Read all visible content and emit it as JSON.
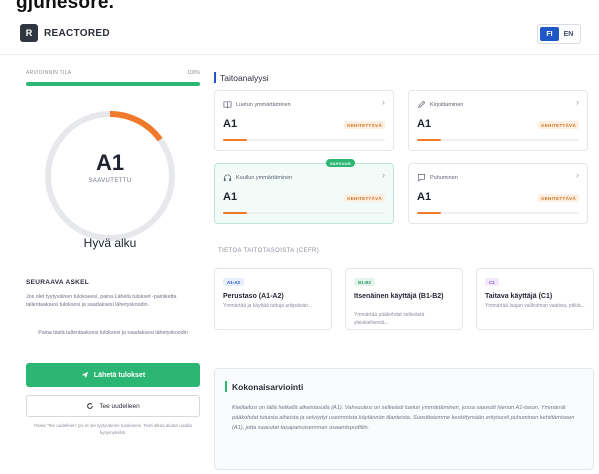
{
  "cropped_heading": "gjuhësorë.",
  "brand": {
    "logo_letter": "R",
    "name": "REACTORED"
  },
  "language": {
    "options": [
      "FI",
      "EN"
    ],
    "active": "FI"
  },
  "progress": {
    "label": "ARVIOINNIN TILA",
    "percent_text": "100%",
    "value": 1.0
  },
  "overall_level": {
    "level": "A1",
    "status": "SAAVUTETTU",
    "ring_fraction": 0.15
  },
  "feedback": "Hyvä alku",
  "next_step": {
    "title": "SEURAAVA ASKEL",
    "text": "Jos olet tyytyväinen tulokseesi, paina Lähetä tulokset -painiketta tallentaaksesi tuloksesi ja saadaksesi lähetyskoodin.",
    "save_note": "Paina tästä tallentaaksesi tuloksesi ja saadaksesi lähetyskoodin",
    "send_label": "Lähetä tulokset",
    "retry_label": "Tee uudelleen",
    "footnote": "Paina 'Tee uudelleen' jos et ole tyytyväinen tulokseesi. Testi alkaa alusta uusilla kysymyksillä."
  },
  "skills_section": {
    "title": "Taitoanalyysi",
    "cards": [
      {
        "name": "Luetun ymmärtäminen",
        "icon": "book-icon",
        "level": "A1",
        "badge": "KEHITETTÄVÄ",
        "progress": 0.15,
        "highlight": false,
        "strength": ""
      },
      {
        "name": "Kirjoittaminen",
        "icon": "pencil-icon",
        "level": "A1",
        "badge": "KEHITETTÄVÄ",
        "progress": 0.15,
        "highlight": false,
        "strength": ""
      },
      {
        "name": "Kuullun ymmärtäminen",
        "icon": "headphones-icon",
        "level": "A1",
        "badge": "KEHITETTÄVÄ",
        "progress": 0.15,
        "highlight": true,
        "strength": "VAHVUUS"
      },
      {
        "name": "Puhuminen",
        "icon": "chat-icon",
        "level": "A1",
        "badge": "KEHITETTÄVÄ",
        "progress": 0.15,
        "highlight": false,
        "strength": ""
      }
    ]
  },
  "cefr": {
    "title": "TIETOA TAITOTASOISTA (CEFR)",
    "cards": [
      {
        "tag": "A1-A2",
        "name": "Perustaso (A1-A2)",
        "desc": "Ymmärtää ja käyttää tuttuja arkipäivän...",
        "tag_color": "#1f57c8",
        "tag_bg": "#e8effc"
      },
      {
        "tag": "B1-B2",
        "name": "Itsenäinen käyttäjä (B1-B2)",
        "desc": "Ymmärtää pääkohdat selkeästä yleiskielisestä...",
        "tag_color": "#2a9a60",
        "tag_bg": "#e3f5ec"
      },
      {
        "tag": "C1",
        "name": "Taitava käyttäjä (C1)",
        "desc": "Ymmärtää laajan valikoiman vaativia, pitkiä...",
        "tag_color": "#8a4fd0",
        "tag_bg": "#f1e9fb"
      }
    ]
  },
  "overall": {
    "title": "Kokonaisarviointi",
    "text": "Kielitaitosi on tällä hetkellä alkeistasolla (A1). Vahvuutesi on selkeästi luetun ymmärtäminen, jossa saavutit hienon A1-tason. Ymmärrät pääkohdat tutuista aiheista ja selviydyt useimmista käytännön tilanteista. Suosittelemme keskittymään erityisesti puhuminen kehittämiseen (A1), jotta saavutat tasapainoisemman osaamisprofiilin."
  },
  "colors": {
    "accent_green": "#2bb673",
    "accent_orange": "#f0792b",
    "brand_blue": "#1f57c8"
  }
}
